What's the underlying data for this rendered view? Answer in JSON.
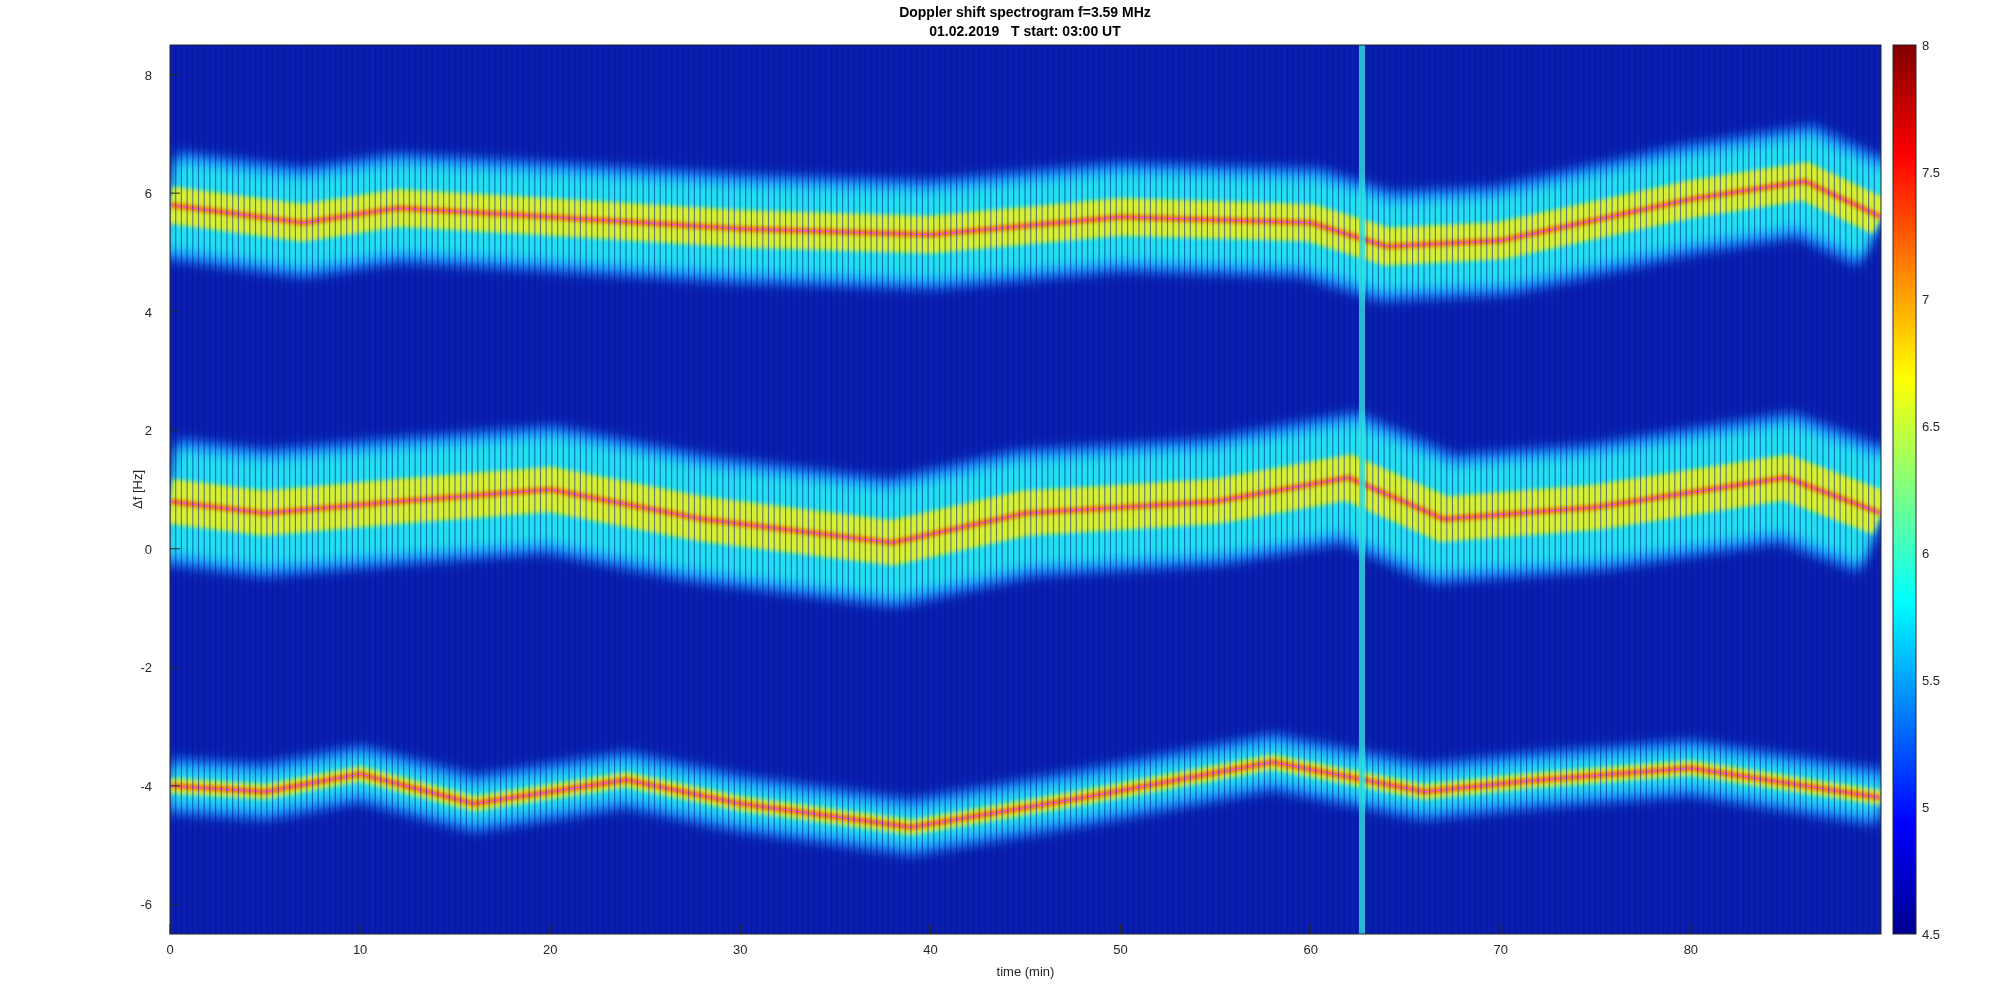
{
  "chart": {
    "title_lines": [
      "Doppler shift spectrogram f=3.59 MHz",
      "01.02.2019   T start: 03:00 UT"
    ],
    "xlabel": "time (min)",
    "ylabel": "Δf [Hz]",
    "xticks": [
      "0",
      "10",
      "20",
      "30",
      "40",
      "50",
      "60",
      "70",
      "80"
    ],
    "yticks": [
      "8",
      "6",
      "4",
      "2",
      "0",
      "-2",
      "-4",
      "-6"
    ],
    "colorbar_ticks": [
      "8",
      "7.5",
      "7",
      "6.5",
      "6",
      "5.5",
      "5",
      "4.5"
    ]
  }
}
